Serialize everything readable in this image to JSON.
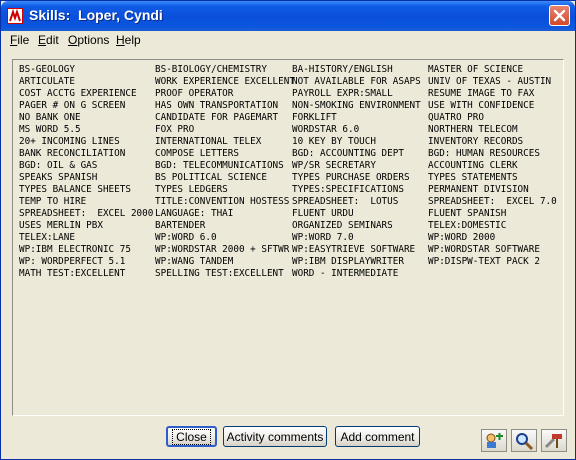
{
  "window": {
    "title": "Skills:  Loper, Cyndi"
  },
  "menu": [
    {
      "label_u": "F",
      "label_rest": "ile"
    },
    {
      "label_u": "E",
      "label_rest": "dit"
    },
    {
      "label_u": "O",
      "label_rest": "ptions"
    },
    {
      "label_u": "H",
      "label_rest": "elp"
    }
  ],
  "skills": {
    "col1": [
      "BS-GEOLOGY",
      "ARTICULATE",
      "COST ACCTG EXPERIENCE",
      "PAGER # ON G SCREEN",
      "NO BANK ONE",
      "MS WORD 5.5",
      "20+ INCOMING LINES",
      "BANK RECONCILIATION",
      "BGD: OIL & GAS",
      "SPEAKS SPANISH",
      "TYPES BALANCE SHEETS",
      "TEMP TO HIRE",
      "SPREADSHEET:  EXCEL 2000",
      "USES MERLIN PBX",
      "TELEX:LANE",
      "WP:IBM ELECTRONIC 75",
      "WP: WORDPERFECT 5.1",
      "MATH TEST:EXCELLENT"
    ],
    "col2": [
      "BS-BIOLOGY/CHEMISTRY",
      "WORK EXPERIENCE EXCELLENT",
      "PROOF OPERATOR",
      "HAS OWN TRANSPORTATION",
      "CANDIDATE FOR PAGEMART",
      "FOX PRO",
      "INTERNATIONAL TELEX",
      "COMPOSE LETTERS",
      "BGD: TELECOMMUNICATIONS",
      "BS POLITICAL SCIENCE",
      "TYPES LEDGERS",
      "TITLE:CONVENTION HOSTESS",
      "LANGUAGE: THAI",
      "BARTENDER",
      "WP:WORD 6.0",
      "WP:WORDSTAR 2000 + SFTWR",
      "WP:WANG TANDEM",
      "SPELLING TEST:EXCELLENT"
    ],
    "col3": [
      "BA-HISTORY/ENGLISH",
      "NOT AVAILABLE FOR ASAPS",
      "PAYROLL EXPR:SMALL",
      "NON-SMOKING ENVIRONMENT",
      "FORKLIFT",
      "WORDSTAR 6.0",
      "10 KEY BY TOUCH",
      "BGD: ACCOUNTING DEPT",
      "WP/SR SECRETARY",
      "TYPES PURCHASE ORDERS",
      "TYPES:SPECIFICATIONS",
      "SPREADSHEET:  LOTUS",
      "FLUENT URDU",
      "ORGANIZED SEMINARS",
      "WP:WORD 7.0",
      "WP:EASYTRIEVE SOFTWARE",
      "WP:IBM DISPLAYWRITER",
      "WORD - INTERMEDIATE"
    ],
    "col4": [
      "MASTER OF SCIENCE",
      "UNIV OF TEXAS - AUSTIN",
      "RESUME IMAGE TO FAX",
      "USE WITH CONFIDENCE",
      "QUATRO PRO",
      "NORTHERN TELECOM",
      "INVENTORY RECORDS",
      "BGD: HUMAN RESOURCES",
      "ACCOUNTING CLERK",
      "TYPES STATEMENTS",
      "PERMANENT DIVISION",
      "SPREADSHEET:  EXCEL 7.0",
      "FLUENT SPANISH",
      "TELEX:DOMESTIC",
      "WP:WORD 2000",
      "WP:WORDSTAR SOFTWARE",
      "WP:DISPW-TEXT PACK 2"
    ]
  },
  "buttons": {
    "close": "Close",
    "activity": "Activity comments",
    "add_comment": "Add comment"
  },
  "icons": {
    "app": "app-icon",
    "window_close": "close-icon",
    "tool1": "find-person-icon",
    "tool2": "search-icon",
    "tool3": "tools-icon"
  }
}
